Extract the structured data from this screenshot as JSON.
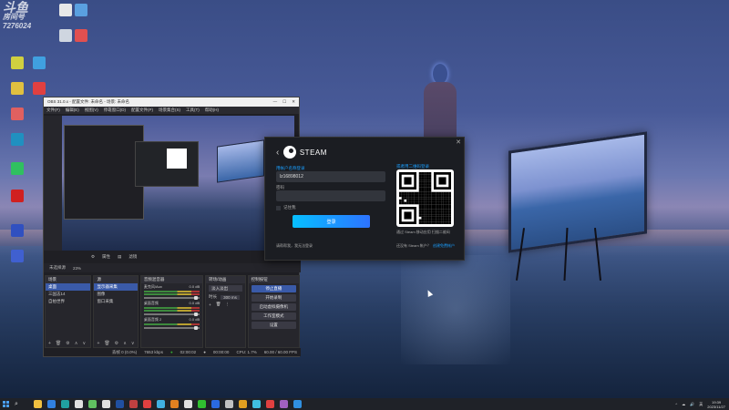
{
  "watermark": {
    "line1": "斗鱼",
    "line2": "房间号",
    "line3": "7276024"
  },
  "desktop_icons": [
    {
      "label": "",
      "color": "#e8e8e8"
    },
    {
      "label": "",
      "color": "#5aa0e0"
    },
    {
      "label": "",
      "color": "#cfd6e0"
    },
    {
      "label": "",
      "color": "#e05050"
    },
    {
      "label": "",
      "color": "#d0d040"
    },
    {
      "label": "",
      "color": "#40a0e0"
    },
    {
      "label": "",
      "color": "#e0c040"
    },
    {
      "label": "",
      "color": "#e04040"
    },
    {
      "label": "",
      "color": "#e06060"
    },
    {
      "label": "",
      "color": "#2090c0"
    },
    {
      "label": "",
      "color": "#30c060"
    },
    {
      "label": "",
      "color": "#d02020"
    },
    {
      "label": "",
      "color": "#3050c0"
    },
    {
      "label": "",
      "color": "#4060d0"
    }
  ],
  "obs": {
    "title": "OBS 31.0.x - 配置文件: 未命名 - 场景: 未命名",
    "menus": [
      "文件(F)",
      "编辑(E)",
      "视图(V)",
      "停靠窗口(D)",
      "配置文件(P)",
      "场景集合(S)",
      "工具(T)",
      "帮助(H)"
    ],
    "window_controls": [
      "—",
      "☐",
      "✕"
    ],
    "mid_bar": {
      "source_label": "未选择源",
      "properties": "属性",
      "filters": "滤镜"
    },
    "zoom_label": "23%",
    "docks": {
      "scenes": {
        "title": "场景",
        "items": [
          "桌面",
          "三国志14",
          "自拍世界"
        ]
      },
      "sources": {
        "title": "源",
        "items": [
          "显示器采集",
          "图像",
          "窗口采集"
        ]
      },
      "mixer": {
        "title": "音频混音器",
        "channels": [
          {
            "name": "麦克风/Aux",
            "db": "0.0 dB"
          },
          {
            "name": "桌面音频",
            "db": "0.0 dB"
          },
          {
            "name": "桌面音频 2",
            "db": "0.0 dB"
          }
        ]
      },
      "transitions": {
        "title": "转场/动画",
        "type": "淡入淡出",
        "duration_label": "时长",
        "duration": "300 ms"
      },
      "controls": {
        "title": "控制按钮",
        "buttons": [
          "停止直播",
          "开始录制",
          "启动虚拟摄像机",
          "工作室模式",
          "设置"
        ]
      }
    },
    "status": {
      "dropped": "丢帧 0 (0.0%)",
      "bitrate": "7653 kbps",
      "live": "02:00:02",
      "rec": "00:00:00",
      "cpu": "CPU: 1.7%",
      "fps": "60.00 / 60.00 FPS"
    }
  },
  "steam": {
    "brand": "STEAM",
    "account_label": "用帐户名称登录",
    "account_value": "lz16898012",
    "password_label": "密码",
    "password_value": "",
    "remember_label": "记住我",
    "login_button": "登录",
    "qr_label": "或者用二维码登录",
    "qr_hint": "通过 Steam 移动应用 扫描二维码",
    "help_link": "请帮帮我，我无法登录",
    "no_account": "还没有 Steam 帐户？",
    "create_account": "创建免费帐户",
    "close": "✕"
  },
  "taskbar": {
    "icons": [
      "#f0c040",
      "#3080e0",
      "#20a0a0",
      "#e0e0e0",
      "#60c060",
      "#e0e0e0",
      "#2050a0",
      "#c04040",
      "#e04040",
      "#40b0e0",
      "#e08020",
      "#e0e0e0",
      "#30c030",
      "#2a6ae0",
      "#c0c0c0",
      "#e0a020",
      "#40c0e0",
      "#e04040",
      "#a060c0",
      "#3090e0"
    ],
    "time": "19:39",
    "date": "2023/11/27",
    "tray": [
      "^",
      "☁",
      "🔊",
      "英"
    ]
  }
}
